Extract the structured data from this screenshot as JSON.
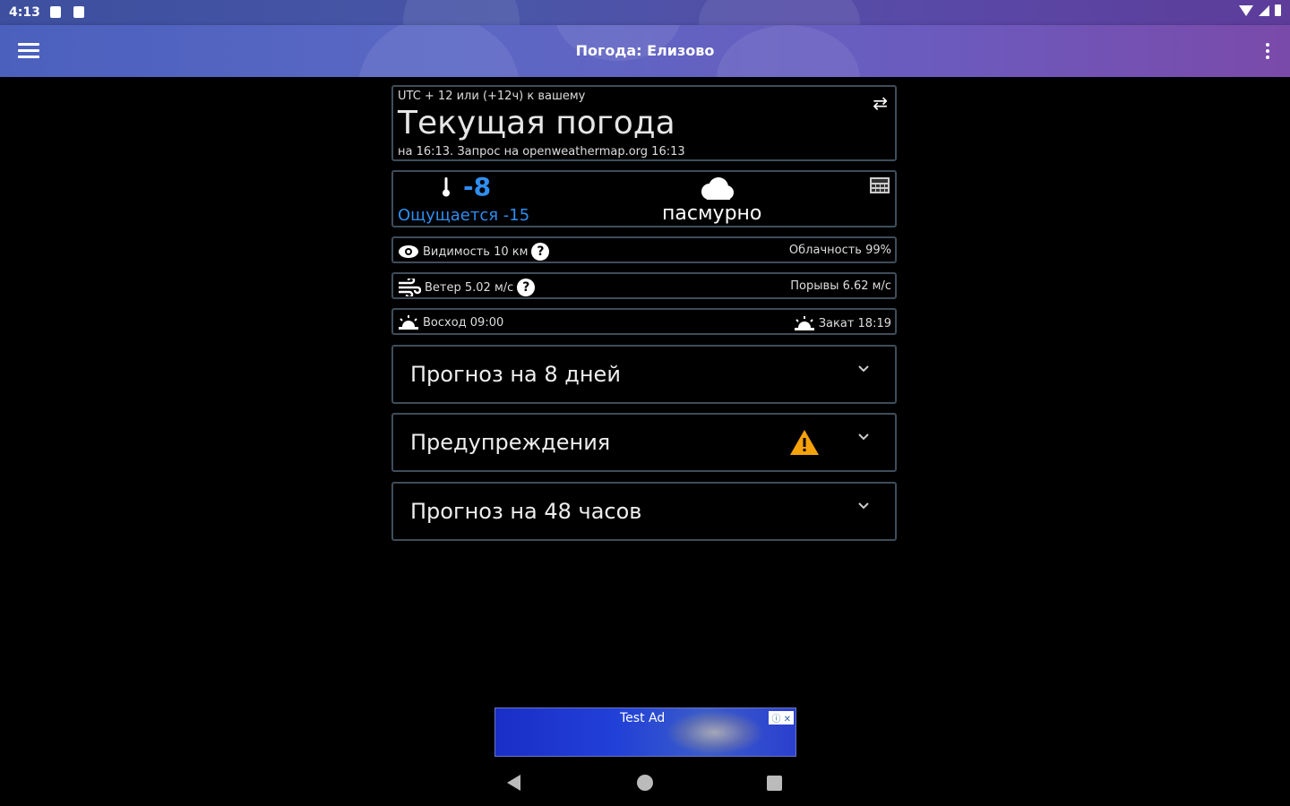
{
  "status_bar": {
    "time": "4:13"
  },
  "app_bar": {
    "title": "Погода: Елизово"
  },
  "current": {
    "utc_offset": "UTC + 12 или (+12ч) к вашему",
    "title": "Текущая погода",
    "subtitle": "на 16:13. Запрос на openweathermap.org 16:13"
  },
  "temperature": {
    "value": "-8",
    "feels_like": "Ощущается -15",
    "condition": "пасмурно",
    "accent_color": "#2f8ef0"
  },
  "visibility": {
    "label": "Видимость 10  км",
    "cloudiness": "Облачность 99%"
  },
  "wind": {
    "label": "Ветер 5.02 м/с",
    "gusts": "Порывы 6.62 м/с"
  },
  "sun": {
    "sunrise": "Восход 09:00",
    "sunset": "Закат 18:19"
  },
  "sections": {
    "forecast_8": "Прогноз на 8 дней",
    "warnings": "Предупреждения",
    "forecast_48": "Прогноз на 48 часов",
    "warning_color": "#f5a20a"
  },
  "ad": {
    "label": "Test Ad",
    "close": "ⓘ ✕"
  },
  "icons": {
    "menu": "menu-icon",
    "more": "more-vert-icon",
    "refresh": "repeat-icon",
    "thermometer": "thermometer-icon",
    "cloud": "cloud-icon",
    "calculator": "calculator-icon",
    "eye": "eye-icon",
    "wind": "wind-icon",
    "sunrise": "sunrise-icon",
    "sunset": "sunset-icon",
    "warning": "warning-icon",
    "chevron": "chevron-down-icon"
  }
}
